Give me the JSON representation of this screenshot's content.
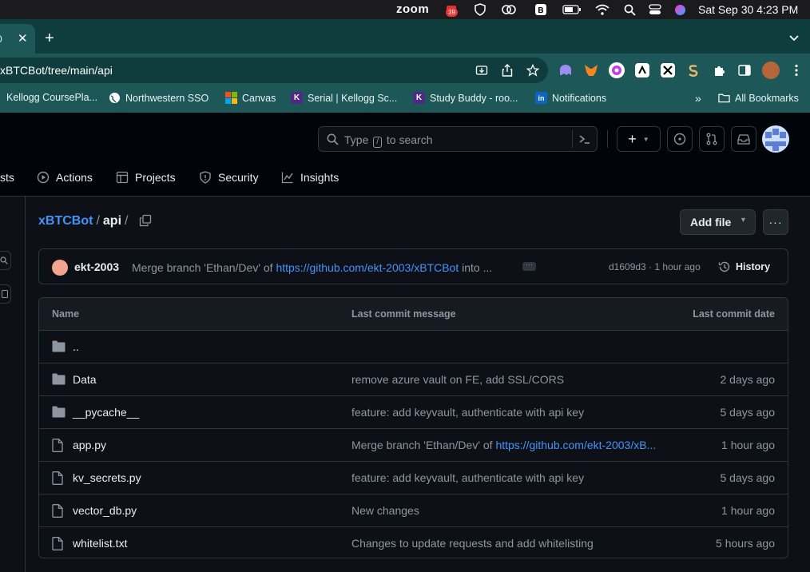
{
  "menubar": {
    "app": "zoom",
    "badge": "39",
    "clock": "Sat Sep 30  4:23 PM"
  },
  "tabs": {
    "partial_title": "0"
  },
  "omnibox": {
    "url": "xBTCBot/tree/main/api"
  },
  "bookmarks": {
    "items": [
      {
        "label": "Kellogg CoursePla..."
      },
      {
        "label": "Northwestern SSO"
      },
      {
        "label": "Canvas"
      },
      {
        "label": "Serial | Kellogg Sc..."
      },
      {
        "label": "Study Buddy - roo..."
      },
      {
        "label": "Notifications"
      }
    ],
    "overflow": "»",
    "all_label": "All Bookmarks"
  },
  "github": {
    "search_prefix": "Type",
    "search_key": "/",
    "search_suffix": "to search",
    "nav": [
      {
        "label": "sts"
      },
      {
        "label": "Actions"
      },
      {
        "label": "Projects"
      },
      {
        "label": "Security"
      },
      {
        "label": "Insights"
      }
    ]
  },
  "breadcrumb": {
    "repo": "xBTCBot",
    "sep": "/",
    "current": "api",
    "trail": "/"
  },
  "actions": {
    "add_file": "Add file",
    "more": "···"
  },
  "commit": {
    "author": "ekt-2003",
    "message_prefix": "Merge branch 'Ethan/Dev' of ",
    "message_link": "https://github.com/ekt-2003/xBTCBot",
    "message_suffix": " into ...",
    "sha_time": "d1609d3 · 1 hour ago",
    "history": "History"
  },
  "table": {
    "headers": {
      "name": "Name",
      "message": "Last commit message",
      "date": "Last commit date"
    },
    "rows": [
      {
        "name": "..",
        "type": "folder",
        "message": "",
        "date": ""
      },
      {
        "name": "Data",
        "type": "folder",
        "message": "remove azure vault on FE, add SSL/CORS",
        "date": "2 days ago"
      },
      {
        "name": "__pycache__",
        "type": "folder",
        "message": "feature: add keyvault, authenticate with api key",
        "date": "5 days ago"
      },
      {
        "name": "app.py",
        "type": "file",
        "message": "Merge branch 'Ethan/Dev' of ",
        "link": "https://github.com/ekt-2003/xB...",
        "date": "1 hour ago"
      },
      {
        "name": "kv_secrets.py",
        "type": "file",
        "message": "feature: add keyvault, authenticate with api key",
        "date": "5 days ago"
      },
      {
        "name": "vector_db.py",
        "type": "file",
        "message": "New changes",
        "date": "1 hour ago"
      },
      {
        "name": "whitelist.txt",
        "type": "file",
        "message": "Changes to update requests and add whitelisting",
        "date": "5 hours ago"
      }
    ]
  },
  "colors": {
    "link": "#4493f8",
    "bg": "#0d1117",
    "chrome_teal": "#1e5757"
  }
}
